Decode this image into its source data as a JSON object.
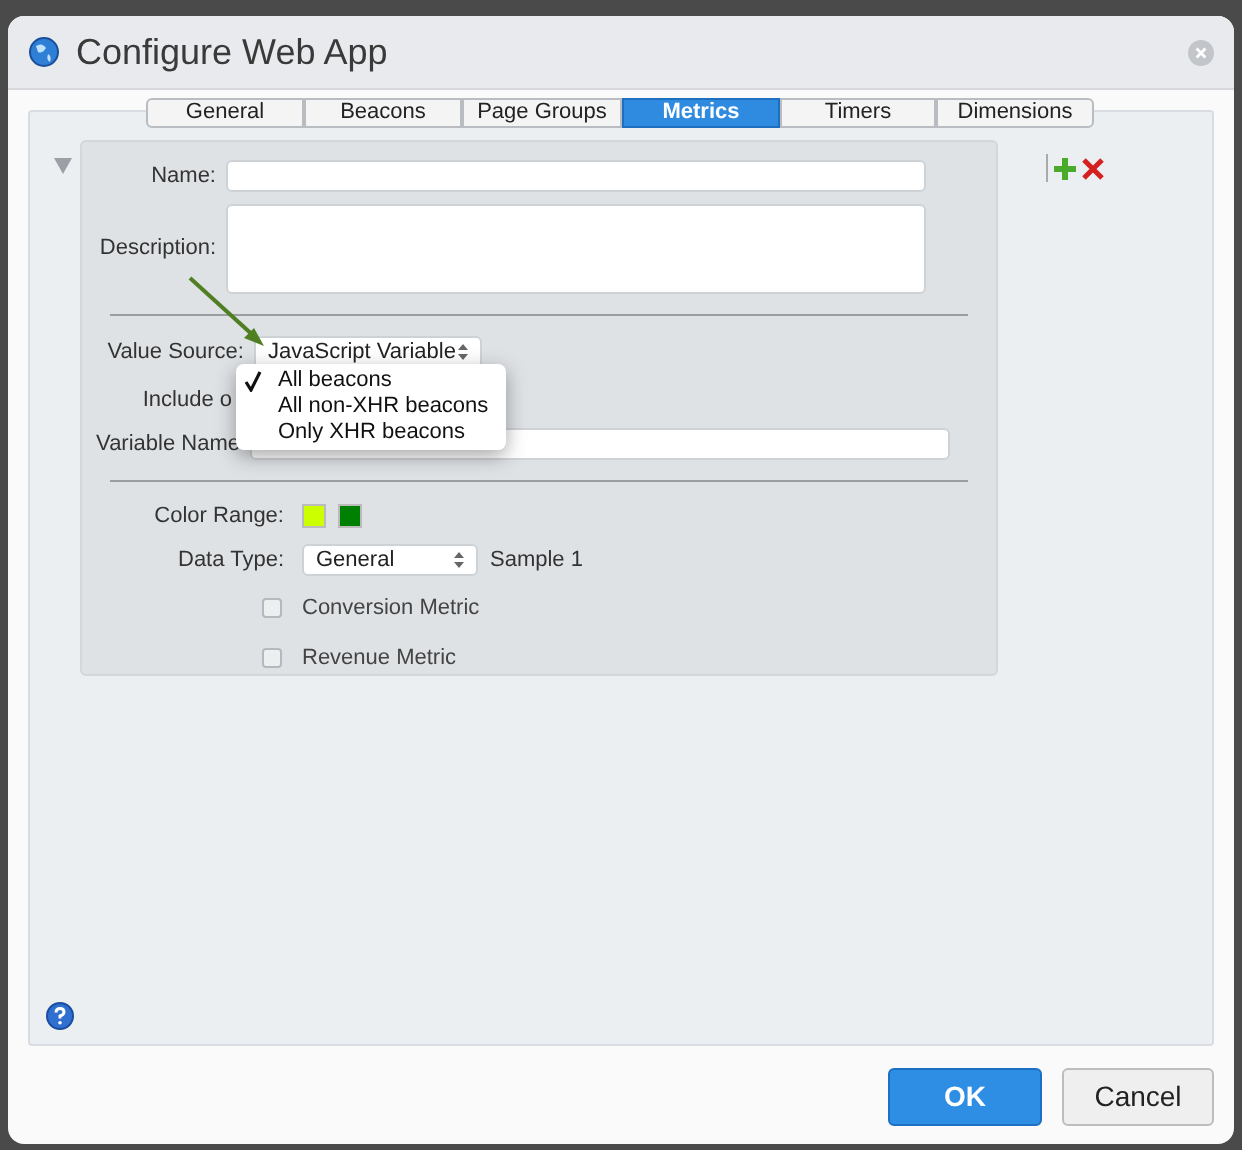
{
  "window": {
    "title": "Configure Web App"
  },
  "tabs": [
    {
      "label": "General",
      "selected": false
    },
    {
      "label": "Beacons",
      "selected": false
    },
    {
      "label": "Page Groups",
      "selected": false
    },
    {
      "label": "Metrics",
      "selected": true
    },
    {
      "label": "Timers",
      "selected": false
    },
    {
      "label": "Dimensions",
      "selected": false
    }
  ],
  "metric": {
    "expanded": true,
    "name": {
      "label": "Name:"
    },
    "description": {
      "label": "Description:"
    },
    "value_source": {
      "label": "Value Source:",
      "value": "JavaScript Variable"
    },
    "include_on": {
      "label": "Include o"
    },
    "variable_name": {
      "label": "Variable Name"
    },
    "color_range": {
      "label": "Color Range:",
      "colors": [
        {
          "color": "#ccff00"
        },
        {
          "color": "#008000"
        }
      ]
    },
    "data_type": {
      "label": "Data Type:",
      "value": "General",
      "note": "Sample 1"
    },
    "checkboxes": [
      {
        "label": "Conversion Metric",
        "checked": false
      },
      {
        "label": "Revenue Metric",
        "checked": false
      }
    ]
  },
  "dropdown_menu": [
    {
      "label": "All beacons",
      "selected": true
    },
    {
      "label": "All non-XHR beacons",
      "selected": false
    },
    {
      "label": "Only XHR beacons",
      "selected": false
    }
  ],
  "buttons": [
    {
      "label": "OK",
      "kind": "primary"
    },
    {
      "label": "Cancel",
      "kind": "secondary"
    }
  ]
}
